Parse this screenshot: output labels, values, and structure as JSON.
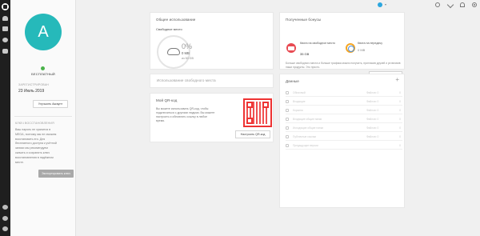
{
  "profile": {
    "avatar_letter": "A",
    "plan": "БЕСПЛАТНЫЙ",
    "registered_label": "ЗАРЕГИСТРИРОВАН",
    "registered_date": "23 Июль 2019",
    "upgrade_label": "Улучшить Аккаунт",
    "recovery_title": "КЛЮЧ ВОССТАНОВЛЕНИЯ",
    "recovery_text": "Ваш пароль не хранится в MEGA, поэтому мы не сможем восстановить его. Для бесплатного доступа к учётной записи мы рекомендуем скачать и сохранить ключ восстановления в надёжном месте.",
    "recovery_button": "Экспортировать ключ"
  },
  "usage": {
    "title": "Общее использование",
    "subtitle": "Свободное место",
    "percent": "0%",
    "used": "0 MB",
    "of_total": "из 50 GB"
  },
  "bonus": {
    "title": "Полученные бонусы",
    "quota_storage_label": "Квота на свободное место",
    "quota_storage_value": "35 GB",
    "quota_transfer_label": "Квота на передачу",
    "quota_transfer_value": "0 MB",
    "description": "Больше свободного места и больше трафика можно получить, пригласив друзей и установив наши продукты. Это просто.",
    "button": "Больше бонусов"
  },
  "analysis": {
    "title": "Использование свободного места"
  },
  "qr": {
    "title": "Мой QR-код",
    "description": "Вы можете использовать QR-код, чтобы подключиться с другими людьми. Вы можете настроить и обновлять ссылку в любое время.",
    "button": "Настроить QR-код"
  },
  "data_card": {
    "title": "Данные",
    "plus": "+",
    "rows": [
      {
        "name": "Облачный",
        "value": "Файлов: 0",
        "num": "0"
      },
      {
        "name": "Входящие",
        "value": "Файлов: 0",
        "num": "0"
      },
      {
        "name": "Корзина",
        "value": "Файлов: 0",
        "num": "0"
      },
      {
        "name": "Входящие общие папки",
        "value": "Файлов: 0",
        "num": "0"
      },
      {
        "name": "Исходящие общие папки",
        "value": "Файлов: 0",
        "num": "0"
      },
      {
        "name": "Публичные ссылки",
        "value": "Файлов: 0",
        "num": "0"
      },
      {
        "name": "Предыдущие версии",
        "value": "",
        "num": "0"
      }
    ]
  }
}
